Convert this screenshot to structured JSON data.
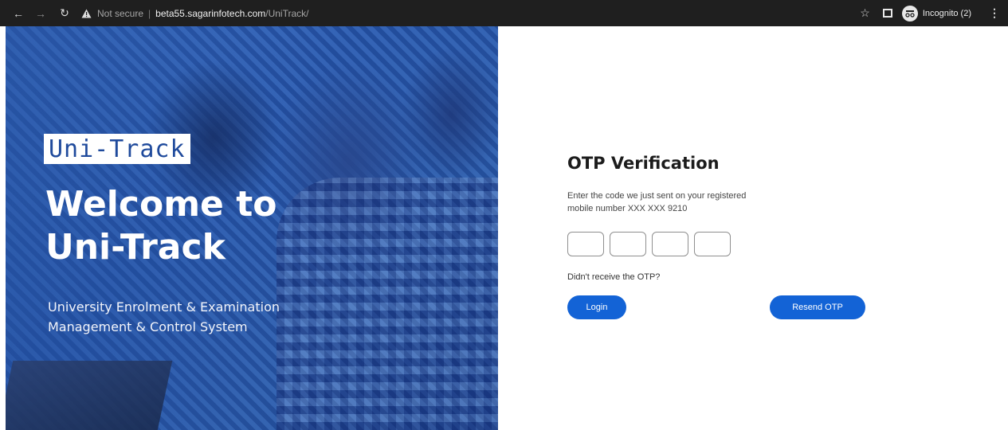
{
  "browser": {
    "security_label": "Not secure",
    "host": "beta55.sagarinfotech.com",
    "path": "/UniTrack/",
    "profile_label": "Incognito (2)"
  },
  "hero": {
    "brand": "Uni-Track",
    "title_line1": "Welcome to",
    "title_line2": "Uni-Track",
    "subtitle_line1": "University Enrolment & Examination",
    "subtitle_line2": "Management & Control System"
  },
  "otp": {
    "title": "OTP Verification",
    "description_line1": "Enter the code we just sent on your registered",
    "description_line2": "mobile number XXX XXX 9210",
    "digits": [
      "",
      "",
      "",
      ""
    ],
    "help_text": "Didn't receive the OTP?",
    "login_label": "Login",
    "resend_label": "Resend OTP"
  },
  "colors": {
    "chrome_bg": "#1f1f1f",
    "hero_blue": "#2a5bb0",
    "brand_text": "#1f4a9c",
    "button_blue": "#1363d6"
  }
}
